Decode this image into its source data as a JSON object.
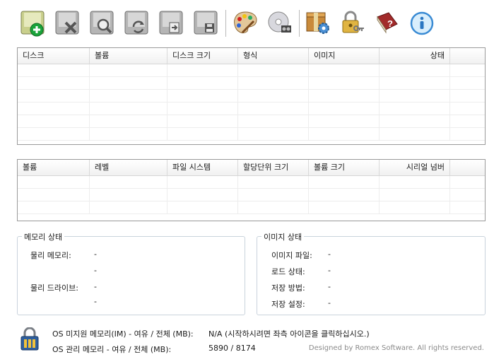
{
  "toolbar": {
    "buttons": [
      {
        "name": "add-disk",
        "icon": "add-disk-icon"
      },
      {
        "name": "remove-disk",
        "icon": "remove-disk-icon"
      },
      {
        "name": "view-disk",
        "icon": "magnify-disk-icon"
      },
      {
        "name": "refresh-disk",
        "icon": "refresh-disk-icon"
      },
      {
        "name": "load-image",
        "icon": "load-image-icon"
      },
      {
        "name": "save-image",
        "icon": "save-disk-icon"
      },
      {
        "name": "palette",
        "icon": "palette-icon"
      },
      {
        "name": "cd-drive",
        "icon": "cd-drive-icon"
      },
      {
        "name": "package-settings",
        "icon": "package-gear-icon"
      },
      {
        "name": "security",
        "icon": "lock-key-icon"
      },
      {
        "name": "help-book",
        "icon": "help-book-icon"
      },
      {
        "name": "info",
        "icon": "info-icon"
      }
    ]
  },
  "disk_table": {
    "columns": [
      "디스크",
      "볼륨",
      "디스크 크기",
      "형식",
      "이미지",
      "상태"
    ],
    "rows": []
  },
  "volume_table": {
    "columns": [
      "볼륨",
      "레벨",
      "파일 시스템",
      "할당단위 크기",
      "볼륨 크기",
      "시리얼 넘버"
    ],
    "rows": []
  },
  "memory_status": {
    "title": "메모리 상태",
    "physical_memory_label": "물리 메모리:",
    "physical_memory_value": "-",
    "physical_memory_value2": "-",
    "physical_drive_label": "물리 드라이브:",
    "physical_drive_value": "-",
    "physical_drive_value2": "-"
  },
  "image_status": {
    "title": "이미지 상태",
    "items": [
      {
        "label": "이미지 파일:",
        "value": "-"
      },
      {
        "label": "로드 상태:",
        "value": "-"
      },
      {
        "label": "저장 방법:",
        "value": "-"
      },
      {
        "label": "저장 설정:",
        "value": "-"
      }
    ]
  },
  "footer": {
    "unmanaged_label": "OS 미지원 메모리(IM) - 여유 / 전체 (MB):",
    "unmanaged_value": "N/A (시작하시려면 좌측 아이콘을 클릭하십시오.)",
    "managed_label": "OS 관리 메모리 - 여유 / 전체 (MB):",
    "managed_value": "5890 / 8174",
    "credit": "Designed by Romex Software. All rights reserved."
  }
}
